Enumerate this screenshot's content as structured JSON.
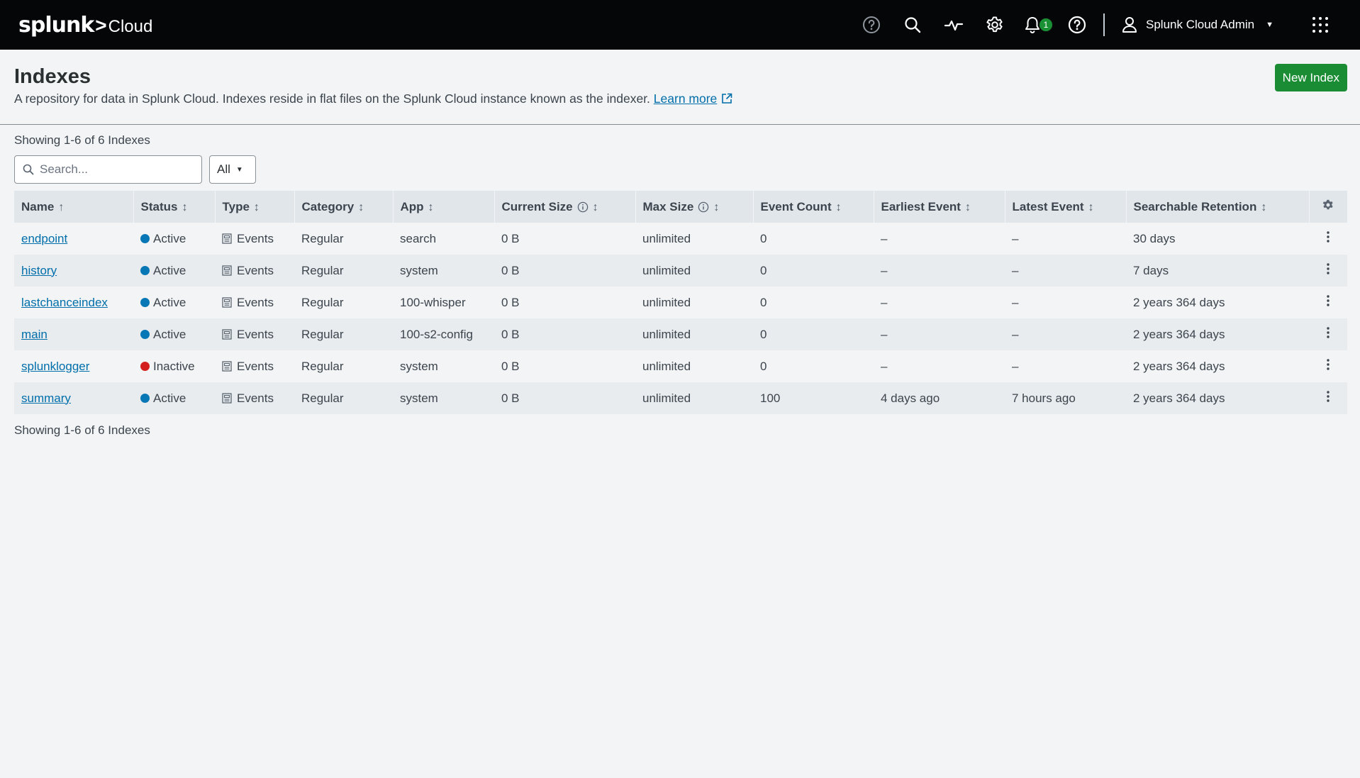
{
  "brand": {
    "splunk": "splunk",
    "separator": ">",
    "product": "Cloud"
  },
  "topnav": {
    "notification_count": "1",
    "user_name": "Splunk Cloud Admin"
  },
  "header": {
    "title": "Indexes",
    "description": "A repository for data in Splunk Cloud. Indexes reside in flat files on the Splunk Cloud instance known as the indexer.",
    "learn_more": "Learn more",
    "new_index_label": "New Index"
  },
  "list": {
    "showing_text": "Showing 1-6 of 6 Indexes",
    "search_placeholder": "Search...",
    "filter_value": "All"
  },
  "table": {
    "columns": [
      "Name",
      "Status",
      "Type",
      "Category",
      "App",
      "Current Size",
      "Max Size",
      "Event Count",
      "Earliest Event",
      "Latest Event",
      "Searchable Retention"
    ],
    "rows": [
      {
        "name": "endpoint",
        "status": "Active",
        "type": "Events",
        "category": "Regular",
        "app": "search",
        "current_size": "0 B",
        "max_size": "unlimited",
        "event_count": "0",
        "earliest": "–",
        "latest": "–",
        "retention": "30 days"
      },
      {
        "name": "history",
        "status": "Active",
        "type": "Events",
        "category": "Regular",
        "app": "system",
        "current_size": "0 B",
        "max_size": "unlimited",
        "event_count": "0",
        "earliest": "–",
        "latest": "–",
        "retention": "7 days"
      },
      {
        "name": "lastchanceindex",
        "status": "Active",
        "type": "Events",
        "category": "Regular",
        "app": "100-whisper",
        "current_size": "0 B",
        "max_size": "unlimited",
        "event_count": "0",
        "earliest": "–",
        "latest": "–",
        "retention": "2 years 364 days"
      },
      {
        "name": "main",
        "status": "Active",
        "type": "Events",
        "category": "Regular",
        "app": "100-s2-config",
        "current_size": "0 B",
        "max_size": "unlimited",
        "event_count": "0",
        "earliest": "–",
        "latest": "–",
        "retention": "2 years 364 days"
      },
      {
        "name": "splunklogger",
        "status": "Inactive",
        "type": "Events",
        "category": "Regular",
        "app": "system",
        "current_size": "0 B",
        "max_size": "unlimited",
        "event_count": "0",
        "earliest": "–",
        "latest": "–",
        "retention": "2 years 364 days"
      },
      {
        "name": "summary",
        "status": "Active",
        "type": "Events",
        "category": "Regular",
        "app": "system",
        "current_size": "0 B",
        "max_size": "unlimited",
        "event_count": "100",
        "earliest": "4 days ago",
        "latest": "7 hours ago",
        "retention": "2 years 364 days"
      }
    ]
  },
  "icons": {
    "help": "question-circle-icon",
    "search": "search-icon",
    "activity": "activity-icon",
    "settings": "gear-icon",
    "notifications": "bell-icon",
    "help2": "question-circle-icon",
    "user": "user-icon",
    "apps": "grid-icon",
    "external": "external-link-icon",
    "info": "info-icon",
    "events": "events-icon",
    "row_actions": "kebab-icon"
  },
  "colors": {
    "topbar": "#050607",
    "primary_button": "#1a8c33",
    "link": "#006eaa",
    "status_active": "#0877b5",
    "status_inactive": "#d41f1f",
    "badge": "#1a9035"
  }
}
